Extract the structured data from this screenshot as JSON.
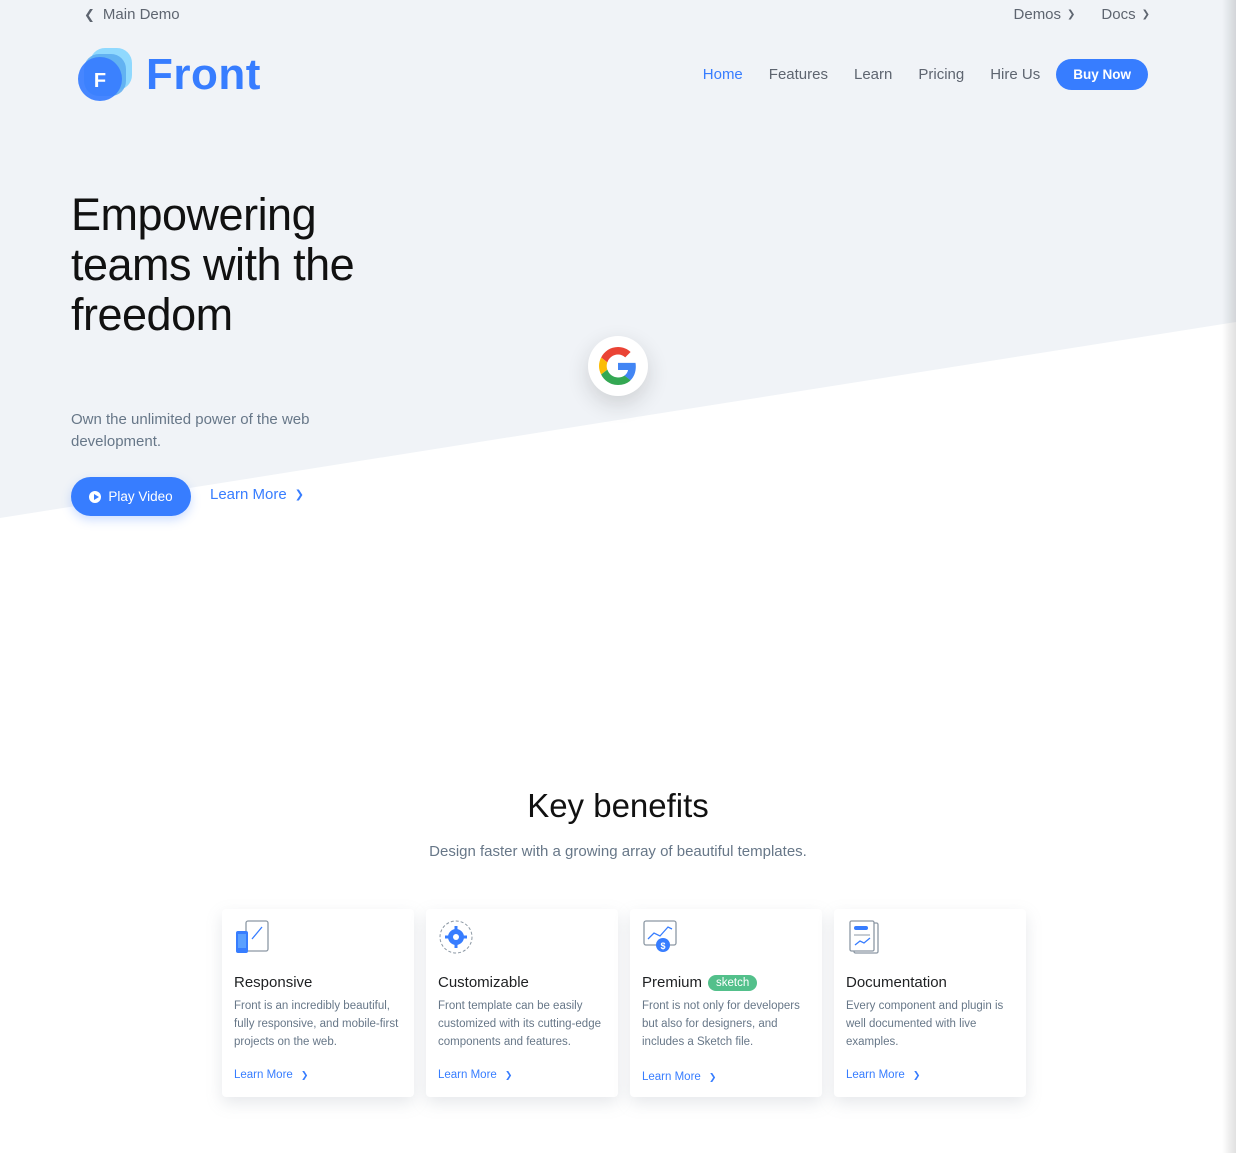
{
  "topbar": {
    "back_label": "Main Demo",
    "dropdowns": [
      {
        "label": "Demos"
      },
      {
        "label": "Docs"
      }
    ]
  },
  "header": {
    "logo_text": "Front",
    "logo_letter": "F",
    "nav": [
      {
        "label": "Home",
        "active": true
      },
      {
        "label": "Features"
      },
      {
        "label": "Learn"
      },
      {
        "label": "Pricing"
      },
      {
        "label": "Hire Us"
      }
    ],
    "buy_label": "Buy Now"
  },
  "hero": {
    "title": "Empowering teams with the freedom",
    "subtitle": "Own the unlimited power of the web development.",
    "play_label": "Play Video",
    "learn_more_label": "Learn More"
  },
  "benefits": {
    "title": "Key benefits",
    "subtitle": "Design faster with a growing array of beautiful templates.",
    "cards": [
      {
        "title": "Responsive",
        "badge": "",
        "text": "Front is an incredibly beautiful, fully responsive, and mobile-first projects on the web.",
        "link": "Learn More",
        "icon": "responsive-devices-icon"
      },
      {
        "title": "Customizable",
        "badge": "",
        "text": "Front template can be easily customized with its cutting-edge components and features.",
        "link": "Learn More",
        "icon": "gear-icon"
      },
      {
        "title": "Premium",
        "badge": "sketch",
        "text": "Front is not only for developers but also for designers, and includes a Sketch file.",
        "link": "Learn More",
        "icon": "chart-dollar-icon"
      },
      {
        "title": "Documentation",
        "badge": "",
        "text": "Every component and plugin is well documented with live examples.",
        "link": "Learn More",
        "icon": "document-icon"
      }
    ]
  },
  "colors": {
    "primary": "#377dff",
    "hero_bg": "#f0f3f7",
    "badge": "#53c08b",
    "muted_text": "#677788"
  }
}
